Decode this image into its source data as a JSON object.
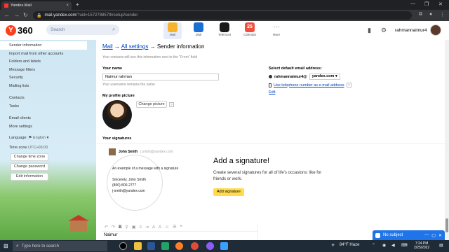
{
  "browser": {
    "tab_title": "Yandex.Mail",
    "tab_close": "×",
    "new_tab": "+",
    "url_host": "mail.yandex.com",
    "url_rest": "/?uid=1572788579#setup/sender",
    "win_min": "—",
    "win_max": "❐",
    "win_close": "✕"
  },
  "header": {
    "logo_y": "Y",
    "logo_360": "360",
    "search_placeholder": "Search",
    "services": [
      {
        "label": "Mail"
      },
      {
        "label": "Disk"
      },
      {
        "label": "Telemost"
      },
      {
        "label": "Calendar",
        "badge": "25"
      },
      {
        "label": "More"
      }
    ],
    "username": "rahmannaimur4"
  },
  "sidebar": {
    "items": [
      {
        "label": "Sender information"
      },
      {
        "label": "Import mail from other accounts"
      },
      {
        "label": "Folders and labels"
      },
      {
        "label": "Message filters"
      },
      {
        "label": "Security"
      },
      {
        "label": "Mailing lists"
      }
    ],
    "items2": [
      {
        "label": "Contacts"
      },
      {
        "label": "Tasks"
      }
    ],
    "items3": [
      {
        "label": "Email clients"
      },
      {
        "label": "More settings"
      }
    ],
    "language_label": "Language:",
    "language_value": "English",
    "timezone_label": "Time zone",
    "timezone_value": "UTC+06:00",
    "btn_change_tz": "Change time zone",
    "btn_change_pw": "Change password",
    "btn_edit_info": "Edit information"
  },
  "main": {
    "crumb_mail": "Mail",
    "crumb_arrow": "→",
    "crumb_settings": "All settings",
    "crumb_current": "→ Sender information",
    "hint": "Your contacts will see this information next to the \"From\" field",
    "your_name_label": "Your name",
    "your_name_value": "Naimur rahman",
    "username_hint": "Your username remains the same",
    "default_email_label": "Select default email address:",
    "email_user": "rahmannaimur4@",
    "email_domain": "yandex.com",
    "phone_link": "Use telephone number as e-mail address",
    "edit_link": "Edit",
    "profile_pic_label": "My profile picture",
    "change_picture": "Change picture",
    "qmark": "?",
    "signatures_label": "Your signatures",
    "sig_name": "John Smith",
    "sig_email": "j.smith@yandex.com",
    "sig_line1": "An example of a message with a signature",
    "sig_line2": "--",
    "sig_line3": "Sincerely, John Smith",
    "sig_line4": "(800) 800-2777",
    "sig_line5": "j-smith@yandex.com",
    "add_title": "Add a signature!",
    "add_desc": "Create several signatures for all of life's occasions: like for friends or work.",
    "add_button": "Add signature",
    "editor_text": "Naimur"
  },
  "compose": {
    "title": "No subject"
  },
  "taskbar": {
    "search_placeholder": "Type here to search",
    "weather": "84°F  Haze",
    "time": "7:24 PM",
    "date": "2/25/2022"
  }
}
